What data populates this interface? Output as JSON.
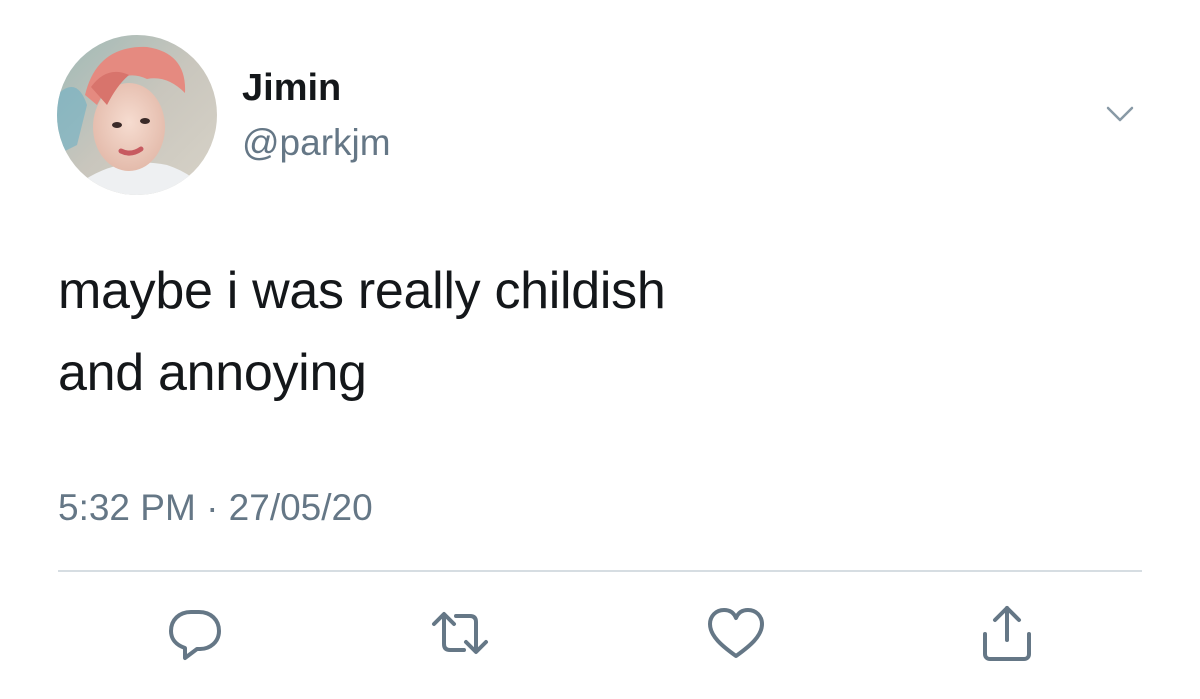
{
  "tweet": {
    "author": {
      "display_name": "Jimin",
      "handle": "@parkjm",
      "avatar_icon": "profile-photo-avatar"
    },
    "text_lines": [
      "maybe i was really childish",
      "and annoying"
    ],
    "timestamp": "5:32 PM · 27/05/20"
  },
  "actions": [
    {
      "name": "reply",
      "icon": "reply-icon"
    },
    {
      "name": "retweet",
      "icon": "retweet-icon"
    },
    {
      "name": "like",
      "icon": "heart-icon"
    },
    {
      "name": "share",
      "icon": "share-icon"
    }
  ],
  "colors": {
    "text": "#14171a",
    "secondary": "#657786",
    "divider": "#d6dde2",
    "icon": "#657786"
  }
}
